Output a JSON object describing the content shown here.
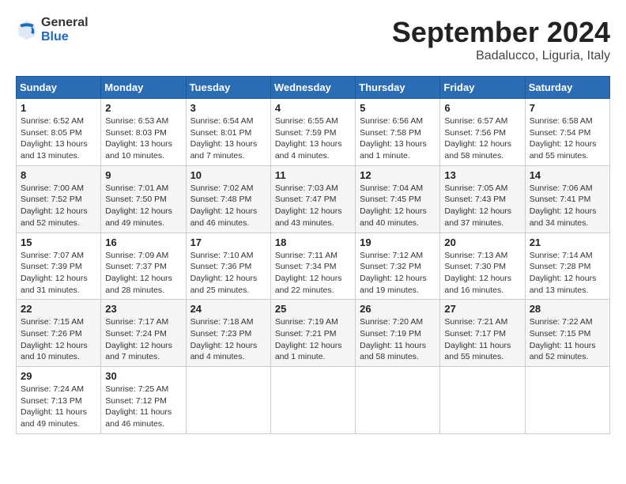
{
  "header": {
    "logo_general": "General",
    "logo_blue": "Blue",
    "month_title": "September 2024",
    "location": "Badalucco, Liguria, Italy"
  },
  "days_of_week": [
    "Sunday",
    "Monday",
    "Tuesday",
    "Wednesday",
    "Thursday",
    "Friday",
    "Saturday"
  ],
  "weeks": [
    [
      {
        "day": "1",
        "info": "Sunrise: 6:52 AM\nSunset: 8:05 PM\nDaylight: 13 hours\nand 13 minutes."
      },
      {
        "day": "2",
        "info": "Sunrise: 6:53 AM\nSunset: 8:03 PM\nDaylight: 13 hours\nand 10 minutes."
      },
      {
        "day": "3",
        "info": "Sunrise: 6:54 AM\nSunset: 8:01 PM\nDaylight: 13 hours\nand 7 minutes."
      },
      {
        "day": "4",
        "info": "Sunrise: 6:55 AM\nSunset: 7:59 PM\nDaylight: 13 hours\nand 4 minutes."
      },
      {
        "day": "5",
        "info": "Sunrise: 6:56 AM\nSunset: 7:58 PM\nDaylight: 13 hours\nand 1 minute."
      },
      {
        "day": "6",
        "info": "Sunrise: 6:57 AM\nSunset: 7:56 PM\nDaylight: 12 hours\nand 58 minutes."
      },
      {
        "day": "7",
        "info": "Sunrise: 6:58 AM\nSunset: 7:54 PM\nDaylight: 12 hours\nand 55 minutes."
      }
    ],
    [
      {
        "day": "8",
        "info": "Sunrise: 7:00 AM\nSunset: 7:52 PM\nDaylight: 12 hours\nand 52 minutes."
      },
      {
        "day": "9",
        "info": "Sunrise: 7:01 AM\nSunset: 7:50 PM\nDaylight: 12 hours\nand 49 minutes."
      },
      {
        "day": "10",
        "info": "Sunrise: 7:02 AM\nSunset: 7:48 PM\nDaylight: 12 hours\nand 46 minutes."
      },
      {
        "day": "11",
        "info": "Sunrise: 7:03 AM\nSunset: 7:47 PM\nDaylight: 12 hours\nand 43 minutes."
      },
      {
        "day": "12",
        "info": "Sunrise: 7:04 AM\nSunset: 7:45 PM\nDaylight: 12 hours\nand 40 minutes."
      },
      {
        "day": "13",
        "info": "Sunrise: 7:05 AM\nSunset: 7:43 PM\nDaylight: 12 hours\nand 37 minutes."
      },
      {
        "day": "14",
        "info": "Sunrise: 7:06 AM\nSunset: 7:41 PM\nDaylight: 12 hours\nand 34 minutes."
      }
    ],
    [
      {
        "day": "15",
        "info": "Sunrise: 7:07 AM\nSunset: 7:39 PM\nDaylight: 12 hours\nand 31 minutes."
      },
      {
        "day": "16",
        "info": "Sunrise: 7:09 AM\nSunset: 7:37 PM\nDaylight: 12 hours\nand 28 minutes."
      },
      {
        "day": "17",
        "info": "Sunrise: 7:10 AM\nSunset: 7:36 PM\nDaylight: 12 hours\nand 25 minutes."
      },
      {
        "day": "18",
        "info": "Sunrise: 7:11 AM\nSunset: 7:34 PM\nDaylight: 12 hours\nand 22 minutes."
      },
      {
        "day": "19",
        "info": "Sunrise: 7:12 AM\nSunset: 7:32 PM\nDaylight: 12 hours\nand 19 minutes."
      },
      {
        "day": "20",
        "info": "Sunrise: 7:13 AM\nSunset: 7:30 PM\nDaylight: 12 hours\nand 16 minutes."
      },
      {
        "day": "21",
        "info": "Sunrise: 7:14 AM\nSunset: 7:28 PM\nDaylight: 12 hours\nand 13 minutes."
      }
    ],
    [
      {
        "day": "22",
        "info": "Sunrise: 7:15 AM\nSunset: 7:26 PM\nDaylight: 12 hours\nand 10 minutes."
      },
      {
        "day": "23",
        "info": "Sunrise: 7:17 AM\nSunset: 7:24 PM\nDaylight: 12 hours\nand 7 minutes."
      },
      {
        "day": "24",
        "info": "Sunrise: 7:18 AM\nSunset: 7:23 PM\nDaylight: 12 hours\nand 4 minutes."
      },
      {
        "day": "25",
        "info": "Sunrise: 7:19 AM\nSunset: 7:21 PM\nDaylight: 12 hours\nand 1 minute."
      },
      {
        "day": "26",
        "info": "Sunrise: 7:20 AM\nSunset: 7:19 PM\nDaylight: 11 hours\nand 58 minutes."
      },
      {
        "day": "27",
        "info": "Sunrise: 7:21 AM\nSunset: 7:17 PM\nDaylight: 11 hours\nand 55 minutes."
      },
      {
        "day": "28",
        "info": "Sunrise: 7:22 AM\nSunset: 7:15 PM\nDaylight: 11 hours\nand 52 minutes."
      }
    ],
    [
      {
        "day": "29",
        "info": "Sunrise: 7:24 AM\nSunset: 7:13 PM\nDaylight: 11 hours\nand 49 minutes."
      },
      {
        "day": "30",
        "info": "Sunrise: 7:25 AM\nSunset: 7:12 PM\nDaylight: 11 hours\nand 46 minutes."
      },
      {
        "day": "",
        "info": ""
      },
      {
        "day": "",
        "info": ""
      },
      {
        "day": "",
        "info": ""
      },
      {
        "day": "",
        "info": ""
      },
      {
        "day": "",
        "info": ""
      }
    ]
  ]
}
